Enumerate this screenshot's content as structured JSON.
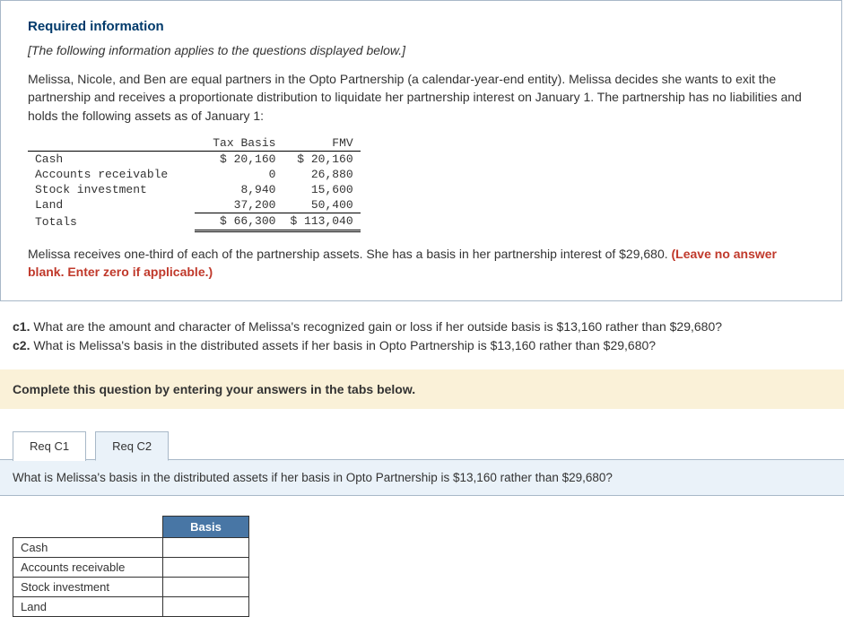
{
  "section_title": "Required information",
  "italic_note": "[The following information applies to the questions displayed below.]",
  "scenario_p1": "Melissa, Nicole, and Ben are equal partners in the Opto Partnership (a calendar-year-end entity). Melissa decides she wants to exit the partnership and receives a proportionate distribution to liquidate her partnership interest on January 1. The partnership has no liabilities and holds the following assets as of January 1:",
  "asset_table": {
    "headers": [
      "Tax Basis",
      "FMV"
    ],
    "rows": [
      {
        "label": "Cash",
        "tax": "$ 20,160",
        "fmv": "$ 20,160"
      },
      {
        "label": "Accounts receivable",
        "tax": "0",
        "fmv": "26,880"
      },
      {
        "label": "Stock investment",
        "tax": "8,940",
        "fmv": "15,600"
      },
      {
        "label": "Land",
        "tax": "37,200",
        "fmv": "50,400"
      }
    ],
    "totals": {
      "label": "Totals",
      "tax": "$ 66,300",
      "fmv": "$ 113,040"
    }
  },
  "scenario_p2_a": "Melissa receives one-third of each of the partnership assets. She has a basis in her partnership interest of $29,680. ",
  "scenario_p2_b": "(Leave no answer blank. Enter zero if applicable.)",
  "questions": {
    "c1_label": "c1.",
    "c1_text": " What are the amount and character of Melissa's recognized gain or loss if her outside basis is $13,160 rather than $29,680?",
    "c2_label": "c2.",
    "c2_text": " What is Melissa's basis in the distributed assets if her basis in Opto Partnership is $13,160 rather than $29,680?"
  },
  "instruction": "Complete this question by entering your answers in the tabs below.",
  "tabs": {
    "tab1": "Req C1",
    "tab2": "Req C2"
  },
  "active_question": "What is Melissa's basis in the distributed assets if her basis in Opto Partnership is $13,160 rather than $29,680?",
  "answer_grid": {
    "header": "Basis",
    "rows": [
      "Cash",
      "Accounts receivable",
      "Stock investment",
      "Land"
    ]
  }
}
